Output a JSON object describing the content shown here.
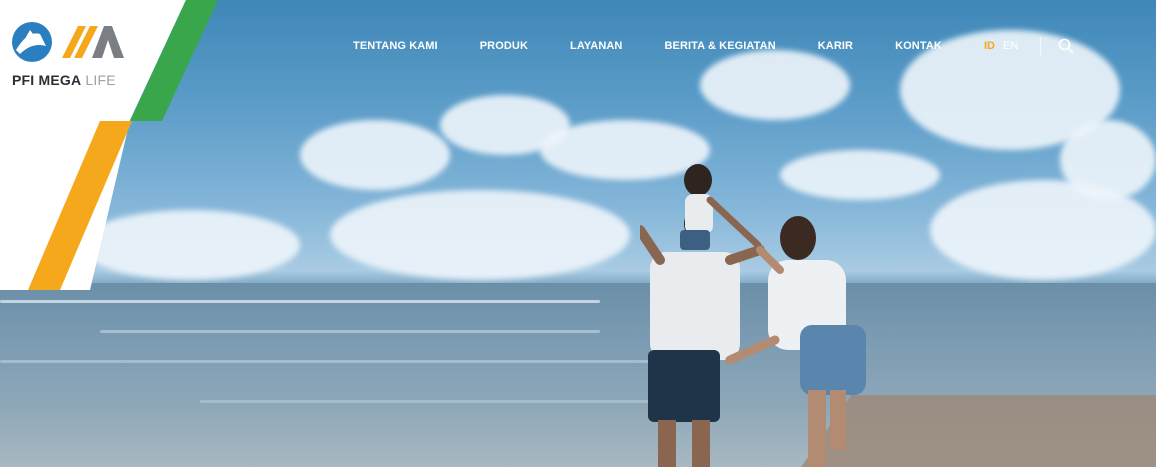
{
  "brand": {
    "name_bold": "PFI MEGA",
    "name_light": "LIFE",
    "colors": {
      "orange": "#f6a81d",
      "green": "#3aa64c",
      "blue": "#2a7fc1",
      "gray": "#7b7f84"
    }
  },
  "nav": {
    "items": [
      {
        "label": "TENTANG KAMI"
      },
      {
        "label": "PRODUK"
      },
      {
        "label": "LAYANAN"
      },
      {
        "label": "BERITA & KEGIATAN"
      },
      {
        "label": "KARIR"
      },
      {
        "label": "KONTAK"
      }
    ]
  },
  "language": {
    "options": [
      "ID",
      "EN"
    ],
    "active": "ID"
  },
  "icons": {
    "search": "search-icon",
    "logo": "pfi-mega-life-logo"
  },
  "hero": {
    "image_alt_subject": "family at the beach"
  }
}
